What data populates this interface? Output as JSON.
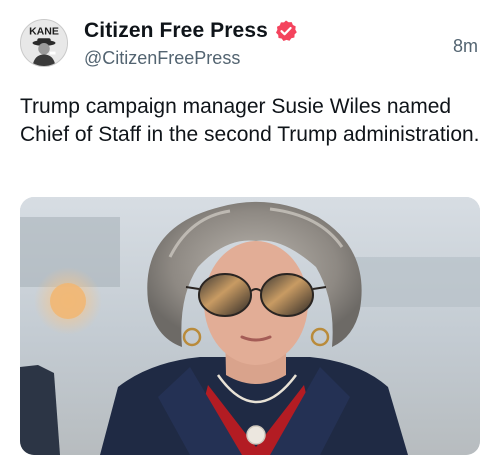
{
  "post": {
    "author": {
      "display_name": "Citizen Free Press",
      "handle": "@CitizenFreePress",
      "verified": true,
      "avatar_text": "KANE"
    },
    "timestamp": "8m",
    "text": "Trump campaign manager Susie Wiles named Chief of Staff in the second Trump administration.",
    "media": {
      "alt": "Photo of a woman with gray curly hair wearing mirrored aviator sunglasses, a dark navy blazer, red top and a pendant necklace"
    }
  },
  "colors": {
    "text_primary": "#0f1419",
    "text_secondary": "#536471",
    "verified_badge": "#f4435d"
  }
}
